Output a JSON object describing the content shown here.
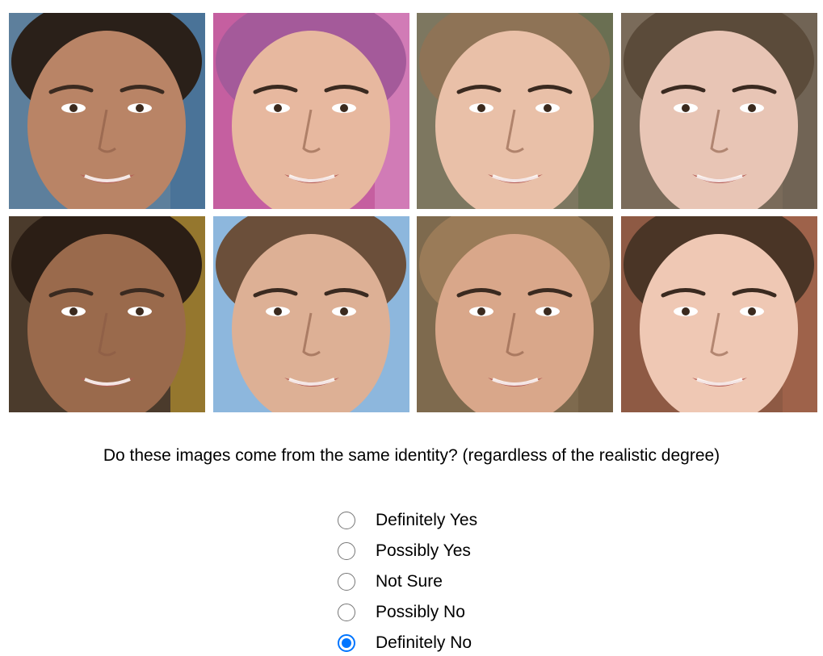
{
  "images": [
    {
      "name": "face-1",
      "bg": "#5d7f9c",
      "skin": "#b98466",
      "hair": "#2a2019",
      "accent": "#3d6a96"
    },
    {
      "name": "face-2",
      "bg": "#c55fa0",
      "skin": "#e7b89f",
      "hair": "#a45a9a",
      "accent": "#d88ec4"
    },
    {
      "name": "face-3",
      "bg": "#7d7760",
      "skin": "#e9c0a8",
      "hair": "#8e7356",
      "accent": "#5e6b4a"
    },
    {
      "name": "face-4",
      "bg": "#7a6b5a",
      "skin": "#e8c5b5",
      "hair": "#5b4b3a",
      "accent": "#6a5f52"
    },
    {
      "name": "face-5",
      "bg": "#4b3b2c",
      "skin": "#9a6a4c",
      "hair": "#2b1e15",
      "accent": "#c6a030"
    },
    {
      "name": "face-6",
      "bg": "#8db7dd",
      "skin": "#ddb095",
      "hair": "#6b4f3a",
      "accent": "#8db7dd"
    },
    {
      "name": "face-7",
      "bg": "#7e6a4e",
      "skin": "#d9a78a",
      "hair": "#9a7b58",
      "accent": "#6e5a40"
    },
    {
      "name": "face-8",
      "bg": "#8e5a44",
      "skin": "#efc8b4",
      "hair": "#4a3526",
      "accent": "#a8684e"
    }
  ],
  "question": "Do these images come from the same identity? (regardless of the realistic degree)",
  "options": [
    {
      "label": "Definitely Yes",
      "checked": false
    },
    {
      "label": "Possibly Yes",
      "checked": false
    },
    {
      "label": "Not Sure",
      "checked": false
    },
    {
      "label": "Possibly No",
      "checked": false
    },
    {
      "label": "Definitely No",
      "checked": true
    }
  ],
  "colors": {
    "radio_checked": "#0075ff",
    "radio_border": "#767676"
  }
}
